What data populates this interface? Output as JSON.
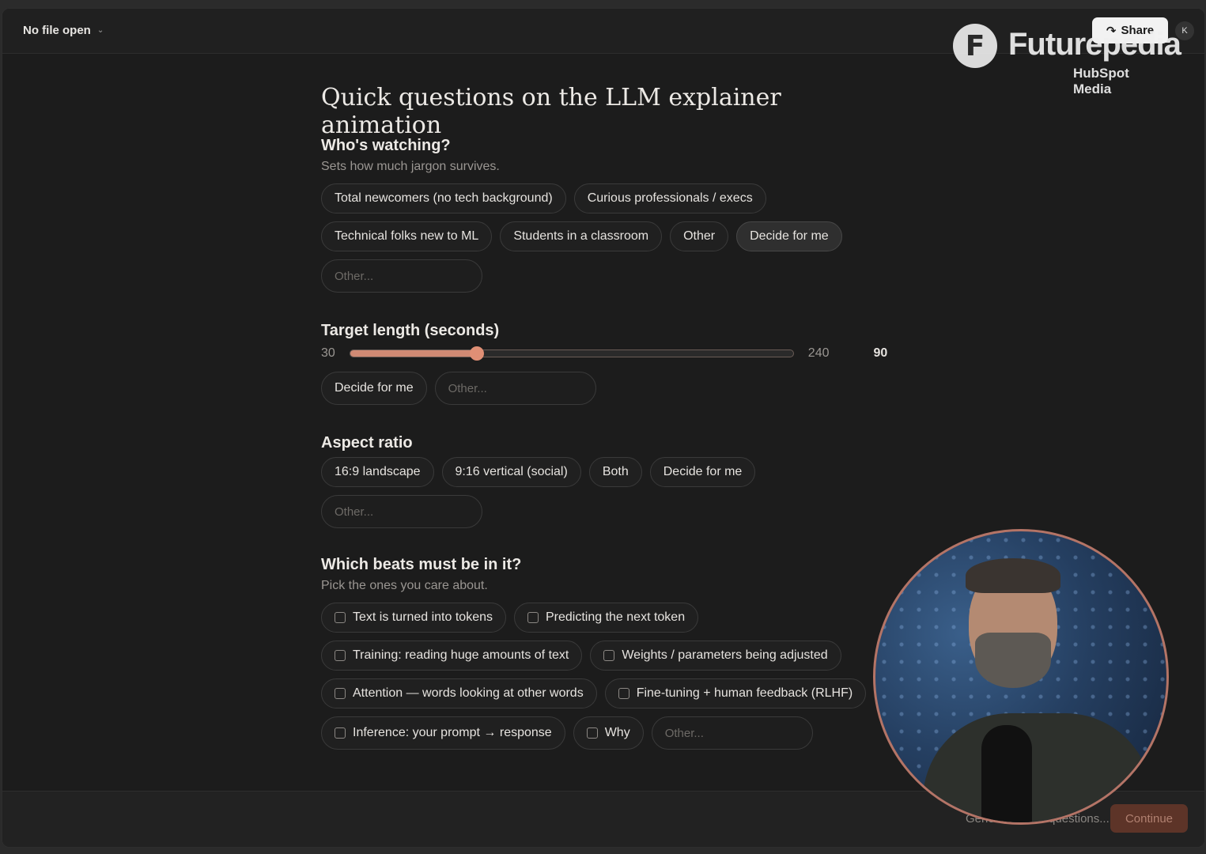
{
  "topbar": {
    "file_label": "No file open",
    "share_label": "Share",
    "avatar_initial": "K"
  },
  "watermark": {
    "brand": "Futurepedia",
    "mark": "F",
    "sub": "HubSpot Media"
  },
  "page_title": "Quick questions on the LLM explainer animation",
  "audience": {
    "title": "Who's watching?",
    "subtitle": "Sets how much jargon survives.",
    "options": [
      "Total newcomers (no tech background)",
      "Curious professionals / execs",
      "Technical folks new to ML",
      "Students in a classroom",
      "Other",
      "Decide for me"
    ],
    "selected": "Decide for me",
    "other_placeholder": "Other..."
  },
  "length": {
    "title": "Target length (seconds)",
    "min": "30",
    "max": "240",
    "value": "90",
    "value_num": 90,
    "min_num": 30,
    "max_num": 240,
    "decide_label": "Decide for me",
    "other_placeholder": "Other..."
  },
  "aspect": {
    "title": "Aspect ratio",
    "options": [
      "16:9 landscape",
      "9:16 vertical (social)",
      "Both",
      "Decide for me"
    ],
    "other_placeholder": "Other..."
  },
  "beats": {
    "title": "Which beats must be in it?",
    "subtitle": "Pick the ones you care about.",
    "options": [
      "Text is turned into tokens",
      "Predicting the next token",
      "Training: reading huge amounts of text",
      "Weights / parameters being adjusted",
      "Attention — words looking at other words",
      "Fine-tuning + human feedback (RLHF)",
      "Inference: your prompt → response",
      "Why"
    ],
    "other_placeholder": "Other..."
  },
  "footer": {
    "generate_label": "Generate more questions...",
    "continue_label": "Continue"
  },
  "colors": {
    "accent": "#d08a74",
    "continue_bg": "#5d3428",
    "background": "#1c1c1c"
  }
}
